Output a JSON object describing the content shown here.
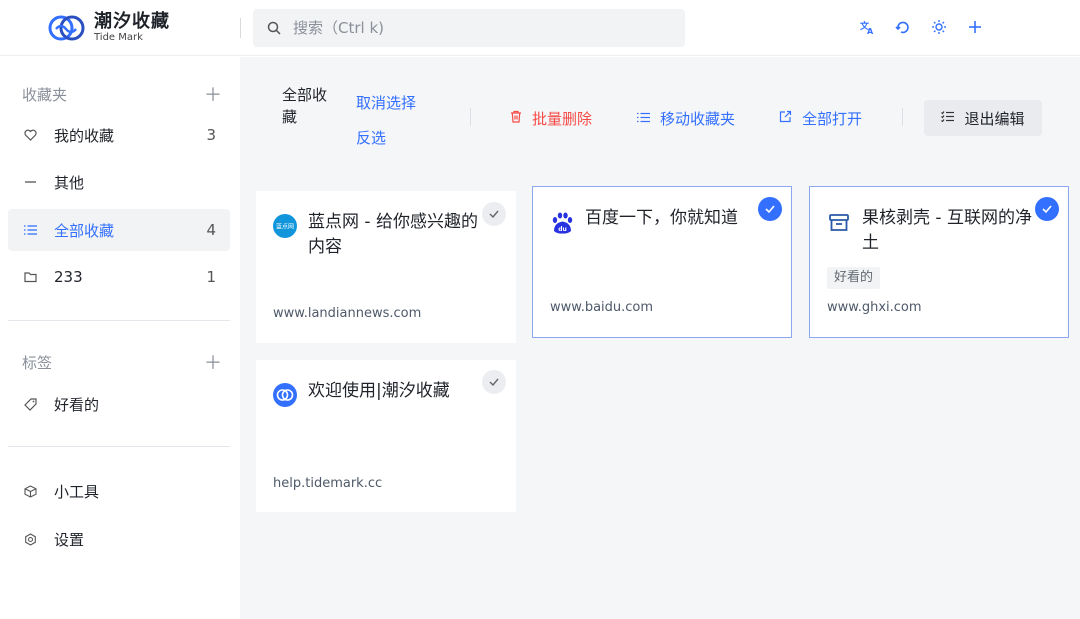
{
  "header": {
    "logo_cn": "潮汐收藏",
    "logo_en": "Tide Mark",
    "search_placeholder": "搜索（Ctrl k)",
    "icons": [
      "translate-icon",
      "sync-icon",
      "settings-sun-icon",
      "plus-icon"
    ]
  },
  "sidebar": {
    "favorites_title": "收藏夹",
    "items": [
      {
        "label": "我的收藏",
        "count": "3",
        "icon": "heart-icon"
      },
      {
        "label": "其他",
        "count": "",
        "icon": "dash-icon"
      },
      {
        "label": "全部收藏",
        "count": "4",
        "icon": "list-icon",
        "active": true
      },
      {
        "label": "233",
        "count": "1",
        "icon": "folder-icon"
      }
    ],
    "tags_title": "标签",
    "tags": [
      {
        "label": "好看的",
        "icon": "tag-icon"
      }
    ],
    "tools": [
      {
        "label": "小工具",
        "icon": "box-icon"
      },
      {
        "label": "设置",
        "icon": "gear-icon"
      }
    ]
  },
  "toolbar": {
    "all_label": "全部收藏",
    "deselect_label": "取消选择",
    "invert_label": "反选",
    "batch_delete_label": "批量删除",
    "move_label": "移动收藏夹",
    "open_all_label": "全部打开",
    "exit_edit_label": "退出编辑"
  },
  "cards": [
    {
      "title": "蓝点网 - 给你感兴趣的内容",
      "url": "www.landiannews.com",
      "tag": "",
      "selected": false,
      "favicon": "landian-icon"
    },
    {
      "title": "百度一下，你就知道",
      "url": "www.baidu.com",
      "tag": "",
      "selected": true,
      "favicon": "baidu-paw-icon"
    },
    {
      "title": "果核剥壳 - 互联网的净土",
      "url": "www.ghxi.com",
      "tag": "好看的",
      "selected": true,
      "favicon": "archive-box-icon"
    },
    {
      "title": "欢迎使用|潮汐收藏",
      "url": "help.tidemark.cc",
      "tag": "",
      "selected": false,
      "favicon": "tidemark-logo-icon"
    }
  ],
  "colors": {
    "accent": "#3370ff",
    "danger": "#f54a45",
    "main_bg": "#f5f6f8"
  }
}
